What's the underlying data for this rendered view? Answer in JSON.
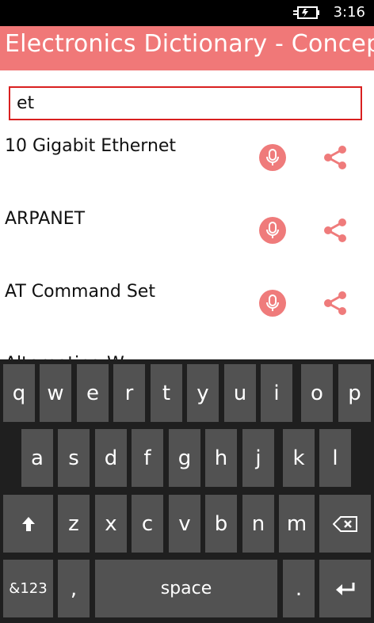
{
  "status_bar": {
    "time": "3:16",
    "battery_icon": "battery-charging-icon"
  },
  "header": {
    "title": "Electronics Dictionary - Concepts Te"
  },
  "search": {
    "value": "et"
  },
  "results": [
    {
      "label": "10 Gigabit Ethernet",
      "mic_icon": "microphone-icon",
      "share_icon": "share-icon"
    },
    {
      "label": "ARPANET",
      "mic_icon": "microphone-icon",
      "share_icon": "share-icon"
    },
    {
      "label": "AT Command Set",
      "mic_icon": "microphone-icon",
      "share_icon": "share-icon"
    }
  ],
  "partial_item": {
    "label": "Alternating W..."
  },
  "keyboard": {
    "row1": [
      "q",
      "w",
      "e",
      "r",
      "t",
      "y",
      "u",
      "i",
      "o",
      "p"
    ],
    "row2": [
      "a",
      "s",
      "d",
      "f",
      "g",
      "h",
      "j",
      "k",
      "l"
    ],
    "row3": [
      "z",
      "x",
      "c",
      "v",
      "b",
      "n",
      "m"
    ],
    "shift_icon": "shift-arrow-icon",
    "backspace_icon": "backspace-icon",
    "symbols_label": "&123",
    "comma_label": ",",
    "space_label": "space",
    "period_label": ".",
    "enter_icon": "enter-icon",
    "colors": {
      "key": "#525252",
      "background": "#1f1f1f"
    }
  },
  "colors": {
    "accent": "#f07878",
    "search_border": "#d92020"
  }
}
